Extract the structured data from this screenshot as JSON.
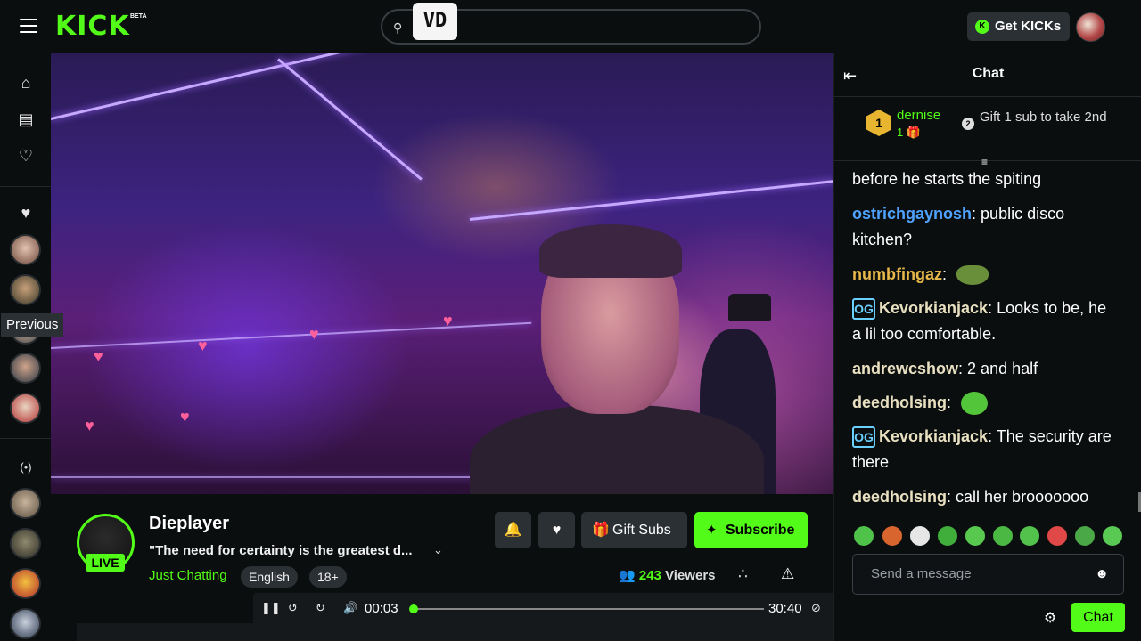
{
  "header": {
    "logo": "KICK",
    "logo_badge": "BETA",
    "search_placeholder": "",
    "overlay_badge": "VD",
    "get_kicks_label": "Get KICKs"
  },
  "sidebar": {
    "tooltip": "Previous",
    "icons": [
      "home-icon",
      "browse-icon",
      "following-icon",
      "favorite-icon",
      "live-icon"
    ]
  },
  "stream": {
    "streamer_name": "Dieplayer",
    "live_label": "LIVE",
    "title": "\"The need for certainty is the greatest d...",
    "category": "Just Chatting",
    "tags": [
      "English",
      "18+"
    ],
    "gift_subs_label": "Gift Subs",
    "subscribe_label": "Subscribe",
    "viewers_count": "243",
    "viewers_label": "Viewers"
  },
  "player": {
    "current_time": "00:03",
    "duration": "30:40",
    "progress": 0.002
  },
  "chat": {
    "title": "Chat",
    "leaderboard": {
      "rank": "1",
      "name": "dernise",
      "count": "1",
      "rank2": "2",
      "gift_text": "Gift 1 sub to take 2nd"
    },
    "messages": [
      {
        "user": "",
        "text": "before he starts the spiting",
        "color": "#ffffff"
      },
      {
        "user": "ostrichgaynosh",
        "text": "public disco kitchen?",
        "color": "#4fa3ff"
      },
      {
        "user": "numbfingaz",
        "text": "",
        "color": "#e8b84a"
      },
      {
        "user": "Kevorkianjack",
        "text": "Looks to be, he a lil too comfortable.",
        "color": "#e8e0c0"
      },
      {
        "user": "andrewcshow",
        "text": "2 and half",
        "color": "#e8e0c0"
      },
      {
        "user": "deedholsing",
        "text": "",
        "color": "#e8e0c0"
      },
      {
        "user": "Kevorkianjack",
        "text": "The security are there",
        "color": "#e8e0c0"
      },
      {
        "user": "deedholsing",
        "text": "call her brooooooo",
        "color": "#e8e0c0"
      }
    ],
    "input_placeholder": "Send a message",
    "send_label": "Chat"
  },
  "colors": {
    "accent": "#53fc18",
    "background": "#0b0e0f",
    "button": "#2b3035"
  }
}
